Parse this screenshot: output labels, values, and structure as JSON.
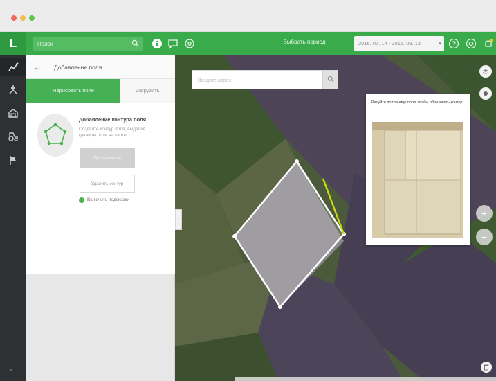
{
  "header": {
    "logo": "L",
    "search_placeholder": "Поиск",
    "center_label": "Выбрать период",
    "date_range": "2016. 07. 14 - 2016. 09. 13"
  },
  "panel": {
    "title": "Добавление поля",
    "tabs": [
      {
        "label": "Нарисовать поле",
        "active": true
      },
      {
        "label": "Загрузить",
        "active": false
      }
    ],
    "card": {
      "title": "Добавление контура поля",
      "description": "Создайте контур поля, выделив границы поля на карте",
      "primary_button": "Продолжить",
      "secondary_button": "Удалить контур",
      "checkbox_label": "Включить подсказки"
    }
  },
  "map": {
    "search_placeholder": "Введите адрес",
    "preview_text": "Рисуйте по границе поля, чтобы образовать контур",
    "icons": [
      "layers-icon",
      "compass-icon",
      "zoom-in-icon",
      "zoom-out-icon",
      "trash-icon"
    ],
    "zoom_in": "+",
    "zoom_out": "−"
  },
  "rail": {
    "icons": [
      "fields-icon",
      "satellite-icon",
      "warehouse-icon",
      "machinery-icon",
      "flag-icon"
    ],
    "expand_arrow": "›"
  },
  "colors": {
    "brand_green": "#39ab4a",
    "rail_dark": "#2e3134",
    "polygon_stroke": "#ffffff",
    "guide_line": "#c8d416"
  }
}
